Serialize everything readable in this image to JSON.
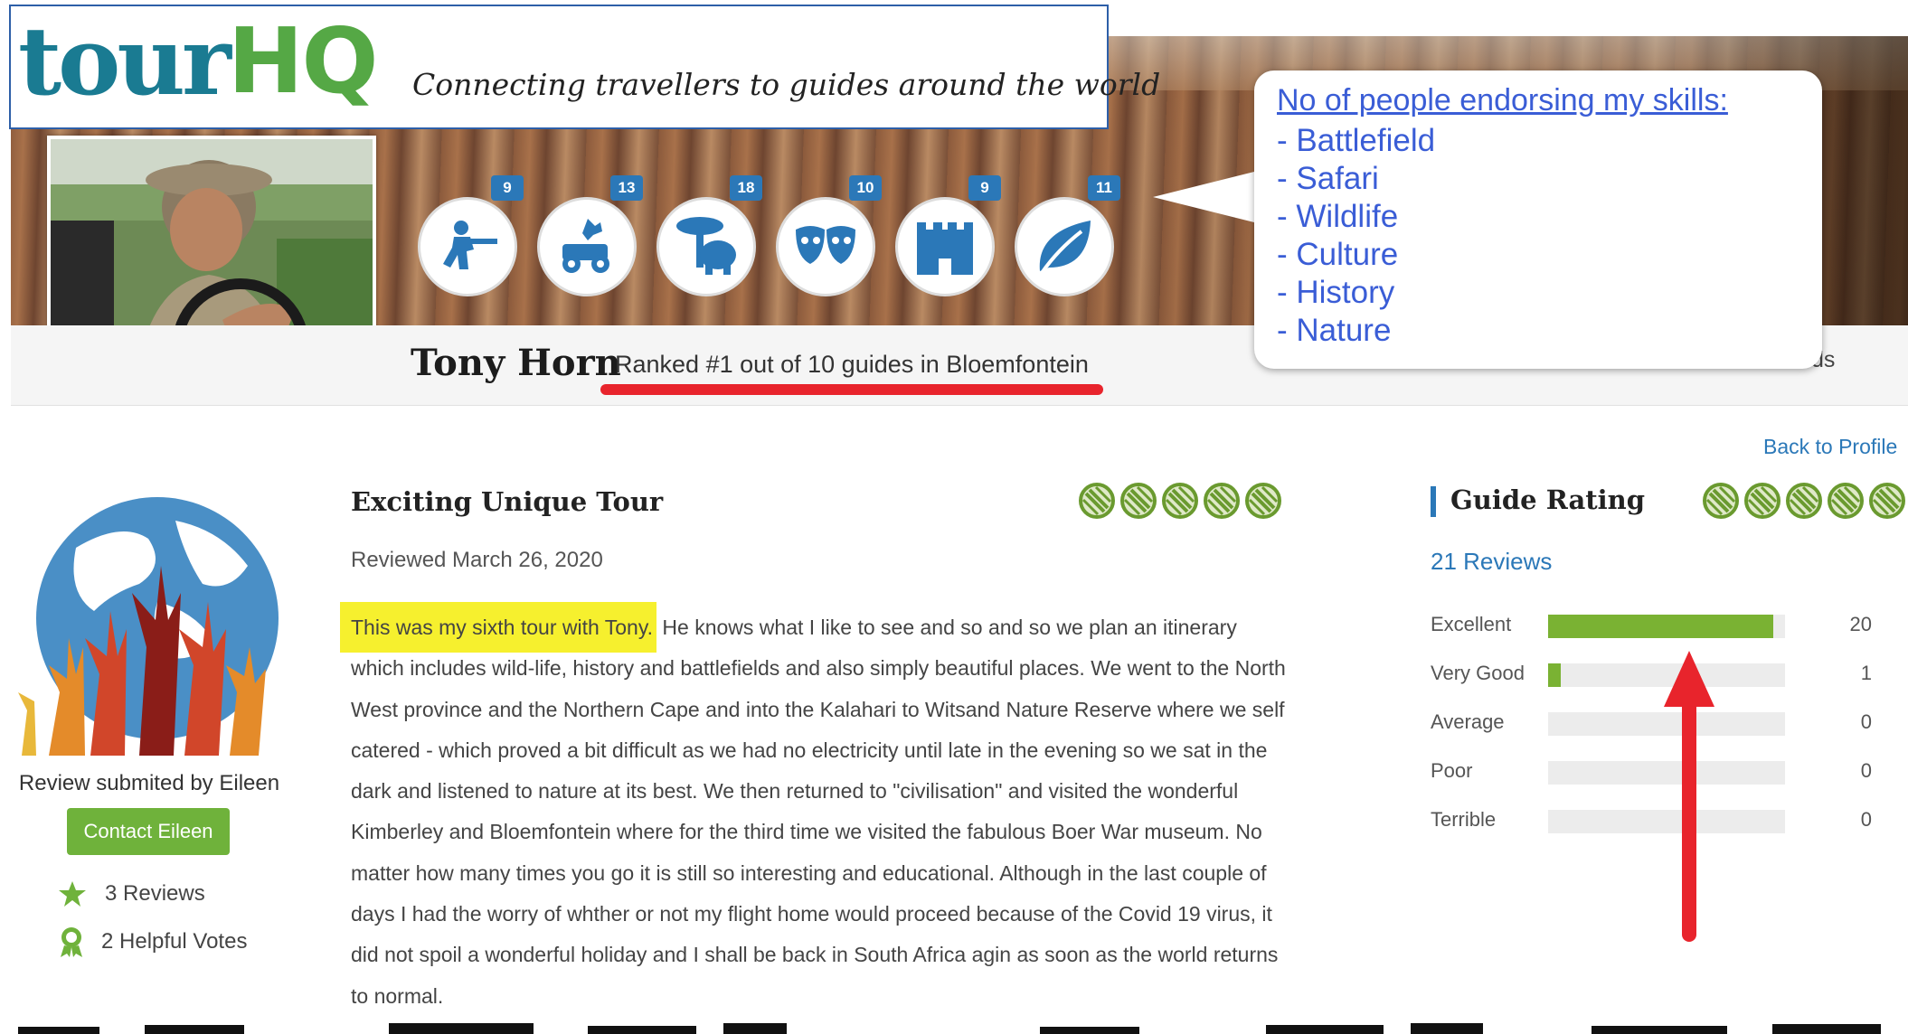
{
  "header": {
    "logo_tour": "tour",
    "logo_hq": "HQ",
    "tagline": "Connecting travellers to guides around the world"
  },
  "profile": {
    "name": "Tony Horn",
    "rank": "Ranked #1 out of 10 guides in Bloemfontein",
    "friends": "Friends"
  },
  "skills": [
    {
      "name": "Battlefield",
      "count": "9",
      "icon": "battlefield-icon"
    },
    {
      "name": "Safari",
      "count": "13",
      "icon": "safari-icon"
    },
    {
      "name": "Wildlife",
      "count": "18",
      "icon": "wildlife-icon"
    },
    {
      "name": "Culture",
      "count": "10",
      "icon": "culture-icon"
    },
    {
      "name": "History",
      "count": "9",
      "icon": "history-icon"
    },
    {
      "name": "Nature",
      "count": "11",
      "icon": "nature-icon"
    }
  ],
  "callout": {
    "title": "No of people endorsing my skills:",
    "items": [
      "- Battlefield",
      "- Safari",
      "- Wildlife",
      "- Culture",
      "- History",
      "- Nature"
    ]
  },
  "reviewer": {
    "caption": "Review submited by Eileen",
    "contact_label": "Contact Eileen",
    "reviews": "3 Reviews",
    "helpful_votes": "2 Helpful Votes"
  },
  "review": {
    "title": "Exciting Unique Tour",
    "date": "Reviewed March 26, 2020",
    "rating": 5,
    "highlight": "This was my sixth tour with Tony.",
    "body": " He knows what I like to see and so and so we plan an itinerary which includes wild-life, history and battlefields and also simply beautiful places. We went to the North West province and the Northern Cape and into the Kalahari to Witsand Nature Reserve where we self catered - which proved a bit difficult as we had no electricity until late in the evening so we sat in the dark and listened to nature at its best. We then returned to \"civilisation\" and visited the wonderful Kimberley and Bloemfontein where for the third time we visited the fabulous Boer War museum. No matter how many times you go it is still so interesting and educational. Although in the last couple of days I had the worry of whther or not my flight home would proceed because of the Covid 19 virus, it did not spoil a wonderful holiday and I shall be back in South Africa agin as soon as the world returns to normal."
  },
  "guide_rating": {
    "back_link": "Back to Profile",
    "title": "Guide Rating",
    "rating": 5,
    "reviews": "21 Reviews",
    "rows": [
      {
        "label": "Excellent",
        "count": "20",
        "fraction": 0.952
      },
      {
        "label": "Very Good",
        "count": "1",
        "fraction": 0.048
      },
      {
        "label": "Average",
        "count": "0",
        "fraction": 0
      },
      {
        "label": "Poor",
        "count": "0",
        "fraction": 0
      },
      {
        "label": "Terrible",
        "count": "0",
        "fraction": 0
      }
    ]
  },
  "colors": {
    "accent_blue": "#2b78b8",
    "brand_teal": "#1a7b92",
    "brand_green": "#55a845",
    "bar_green": "#7ab233",
    "button_green": "#6fb23b",
    "rating_green": "#6a9a2f",
    "annotation_red": "#e8242c",
    "highlight_yellow": "#f6f02e",
    "callout_blue": "#3a5dd6"
  }
}
